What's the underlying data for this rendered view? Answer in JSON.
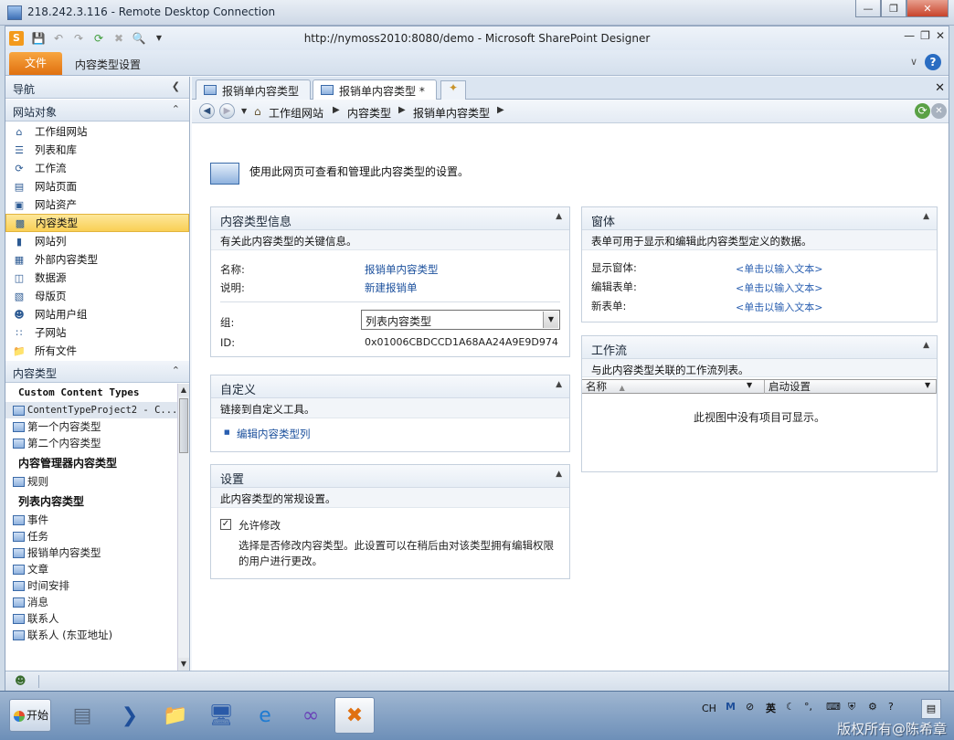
{
  "rdp": {
    "title": "218.242.3.116 - Remote Desktop Connection"
  },
  "app": {
    "title": "http://nymoss2010:8080/demo  -  Microsoft SharePoint Designer"
  },
  "ribbon": {
    "file_tab": "文件",
    "context_tab": "内容类型设置"
  },
  "nav": {
    "header": "导航",
    "site_objects_header": "网站对象",
    "items": [
      {
        "label": "工作组网站",
        "icon": "home-icon"
      },
      {
        "label": "列表和库",
        "icon": "list-icon"
      },
      {
        "label": "工作流",
        "icon": "workflow-icon"
      },
      {
        "label": "网站页面",
        "icon": "page-icon"
      },
      {
        "label": "网站资产",
        "icon": "asset-icon"
      },
      {
        "label": "内容类型",
        "icon": "content-type-icon"
      },
      {
        "label": "网站列",
        "icon": "column-icon"
      },
      {
        "label": "外部内容类型",
        "icon": "external-icon"
      },
      {
        "label": "数据源",
        "icon": "database-icon"
      },
      {
        "label": "母版页",
        "icon": "master-page-icon"
      },
      {
        "label": "网站用户组",
        "icon": "group-icon"
      },
      {
        "label": "子网站",
        "icon": "subsite-icon"
      },
      {
        "label": "所有文件",
        "icon": "folder-icon"
      }
    ],
    "selected_index": 5,
    "ct_header": "内容类型",
    "ct_groups": [
      {
        "title": "Custom Content Types",
        "mono": true,
        "items": [
          "ContentTypeProject2 - C...",
          "第一个内容类型",
          "第二个内容类型"
        ]
      },
      {
        "title": "内容管理器内容类型",
        "mono": false,
        "items": [
          "规则"
        ]
      },
      {
        "title": "列表内容类型",
        "mono": false,
        "items": [
          "事件",
          "任务",
          "报销单内容类型",
          "文章",
          "时间安排",
          "消息",
          "联系人",
          "联系人 (东亚地址)"
        ]
      }
    ]
  },
  "doc": {
    "tabs": [
      {
        "label": "报销单内容类型"
      },
      {
        "label": "报销单内容类型 *"
      }
    ],
    "breadcrumb": [
      "工作组网站",
      "内容类型",
      "报销单内容类型"
    ],
    "page_description": "使用此网页可查看和管理此内容类型的设置。",
    "info_panel": {
      "title": "内容类型信息",
      "subtitle": "有关此内容类型的关键信息。",
      "name_label": "名称:",
      "name_value": "报销单内容类型",
      "desc_label": "说明:",
      "desc_value": "新建报销单",
      "group_label": "组:",
      "group_value": "列表内容类型",
      "id_label": "ID:",
      "id_value": "0x01006CBDCCD1A68AA24A9E9D974"
    },
    "custom_panel": {
      "title": "自定义",
      "subtitle": "链接到自定义工具。",
      "link": "编辑内容类型列"
    },
    "settings_panel": {
      "title": "设置",
      "subtitle": "此内容类型的常规设置。",
      "checkbox_label": "允许修改",
      "checked": true,
      "description": "选择是否修改内容类型。此设置可以在稍后由对该类型拥有编辑权限的用户进行更改。"
    },
    "forms_panel": {
      "title": "窗体",
      "subtitle": "表单可用于显示和编辑此内容类型定义的数据。",
      "display_label": "显示窗体:",
      "edit_label": "编辑表单:",
      "new_label": "新表单:",
      "placeholder": "<单击以输入文本>"
    },
    "workflow_panel": {
      "title": "工作流",
      "subtitle": "与此内容类型关联的工作流列表。",
      "col_name": "名称",
      "col_start": "启动设置",
      "empty_message": "此视图中没有项目可显示。"
    }
  },
  "taskbar": {
    "start_label": "开始",
    "tray_lang": "CH",
    "tray_ime": "英",
    "watermark": "版权所有@陈希章"
  }
}
